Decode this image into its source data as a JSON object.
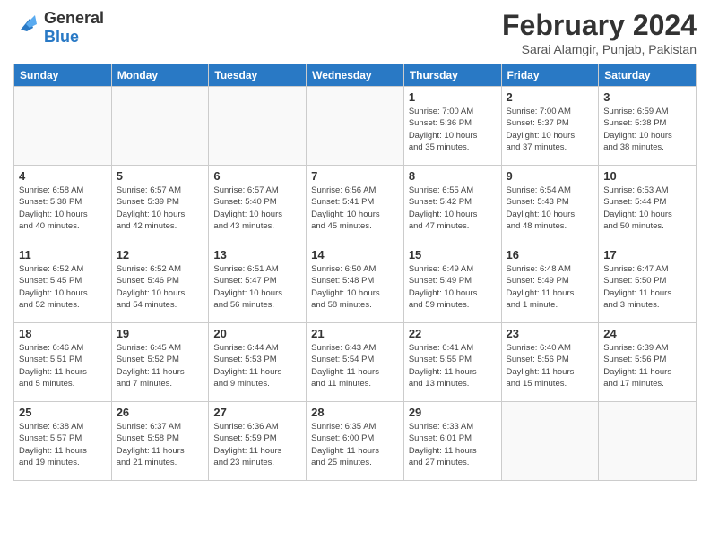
{
  "logo": {
    "line1": "General",
    "line2": "Blue"
  },
  "title": "February 2024",
  "location": "Sarai Alamgir, Punjab, Pakistan",
  "days_header": [
    "Sunday",
    "Monday",
    "Tuesday",
    "Wednesday",
    "Thursday",
    "Friday",
    "Saturday"
  ],
  "weeks": [
    [
      {
        "day": "",
        "info": ""
      },
      {
        "day": "",
        "info": ""
      },
      {
        "day": "",
        "info": ""
      },
      {
        "day": "",
        "info": ""
      },
      {
        "day": "1",
        "info": "Sunrise: 7:00 AM\nSunset: 5:36 PM\nDaylight: 10 hours\nand 35 minutes."
      },
      {
        "day": "2",
        "info": "Sunrise: 7:00 AM\nSunset: 5:37 PM\nDaylight: 10 hours\nand 37 minutes."
      },
      {
        "day": "3",
        "info": "Sunrise: 6:59 AM\nSunset: 5:38 PM\nDaylight: 10 hours\nand 38 minutes."
      }
    ],
    [
      {
        "day": "4",
        "info": "Sunrise: 6:58 AM\nSunset: 5:38 PM\nDaylight: 10 hours\nand 40 minutes."
      },
      {
        "day": "5",
        "info": "Sunrise: 6:57 AM\nSunset: 5:39 PM\nDaylight: 10 hours\nand 42 minutes."
      },
      {
        "day": "6",
        "info": "Sunrise: 6:57 AM\nSunset: 5:40 PM\nDaylight: 10 hours\nand 43 minutes."
      },
      {
        "day": "7",
        "info": "Sunrise: 6:56 AM\nSunset: 5:41 PM\nDaylight: 10 hours\nand 45 minutes."
      },
      {
        "day": "8",
        "info": "Sunrise: 6:55 AM\nSunset: 5:42 PM\nDaylight: 10 hours\nand 47 minutes."
      },
      {
        "day": "9",
        "info": "Sunrise: 6:54 AM\nSunset: 5:43 PM\nDaylight: 10 hours\nand 48 minutes."
      },
      {
        "day": "10",
        "info": "Sunrise: 6:53 AM\nSunset: 5:44 PM\nDaylight: 10 hours\nand 50 minutes."
      }
    ],
    [
      {
        "day": "11",
        "info": "Sunrise: 6:52 AM\nSunset: 5:45 PM\nDaylight: 10 hours\nand 52 minutes."
      },
      {
        "day": "12",
        "info": "Sunrise: 6:52 AM\nSunset: 5:46 PM\nDaylight: 10 hours\nand 54 minutes."
      },
      {
        "day": "13",
        "info": "Sunrise: 6:51 AM\nSunset: 5:47 PM\nDaylight: 10 hours\nand 56 minutes."
      },
      {
        "day": "14",
        "info": "Sunrise: 6:50 AM\nSunset: 5:48 PM\nDaylight: 10 hours\nand 58 minutes."
      },
      {
        "day": "15",
        "info": "Sunrise: 6:49 AM\nSunset: 5:49 PM\nDaylight: 10 hours\nand 59 minutes."
      },
      {
        "day": "16",
        "info": "Sunrise: 6:48 AM\nSunset: 5:49 PM\nDaylight: 11 hours\nand 1 minute."
      },
      {
        "day": "17",
        "info": "Sunrise: 6:47 AM\nSunset: 5:50 PM\nDaylight: 11 hours\nand 3 minutes."
      }
    ],
    [
      {
        "day": "18",
        "info": "Sunrise: 6:46 AM\nSunset: 5:51 PM\nDaylight: 11 hours\nand 5 minutes."
      },
      {
        "day": "19",
        "info": "Sunrise: 6:45 AM\nSunset: 5:52 PM\nDaylight: 11 hours\nand 7 minutes."
      },
      {
        "day": "20",
        "info": "Sunrise: 6:44 AM\nSunset: 5:53 PM\nDaylight: 11 hours\nand 9 minutes."
      },
      {
        "day": "21",
        "info": "Sunrise: 6:43 AM\nSunset: 5:54 PM\nDaylight: 11 hours\nand 11 minutes."
      },
      {
        "day": "22",
        "info": "Sunrise: 6:41 AM\nSunset: 5:55 PM\nDaylight: 11 hours\nand 13 minutes."
      },
      {
        "day": "23",
        "info": "Sunrise: 6:40 AM\nSunset: 5:56 PM\nDaylight: 11 hours\nand 15 minutes."
      },
      {
        "day": "24",
        "info": "Sunrise: 6:39 AM\nSunset: 5:56 PM\nDaylight: 11 hours\nand 17 minutes."
      }
    ],
    [
      {
        "day": "25",
        "info": "Sunrise: 6:38 AM\nSunset: 5:57 PM\nDaylight: 11 hours\nand 19 minutes."
      },
      {
        "day": "26",
        "info": "Sunrise: 6:37 AM\nSunset: 5:58 PM\nDaylight: 11 hours\nand 21 minutes."
      },
      {
        "day": "27",
        "info": "Sunrise: 6:36 AM\nSunset: 5:59 PM\nDaylight: 11 hours\nand 23 minutes."
      },
      {
        "day": "28",
        "info": "Sunrise: 6:35 AM\nSunset: 6:00 PM\nDaylight: 11 hours\nand 25 minutes."
      },
      {
        "day": "29",
        "info": "Sunrise: 6:33 AM\nSunset: 6:01 PM\nDaylight: 11 hours\nand 27 minutes."
      },
      {
        "day": "",
        "info": ""
      },
      {
        "day": "",
        "info": ""
      }
    ]
  ]
}
